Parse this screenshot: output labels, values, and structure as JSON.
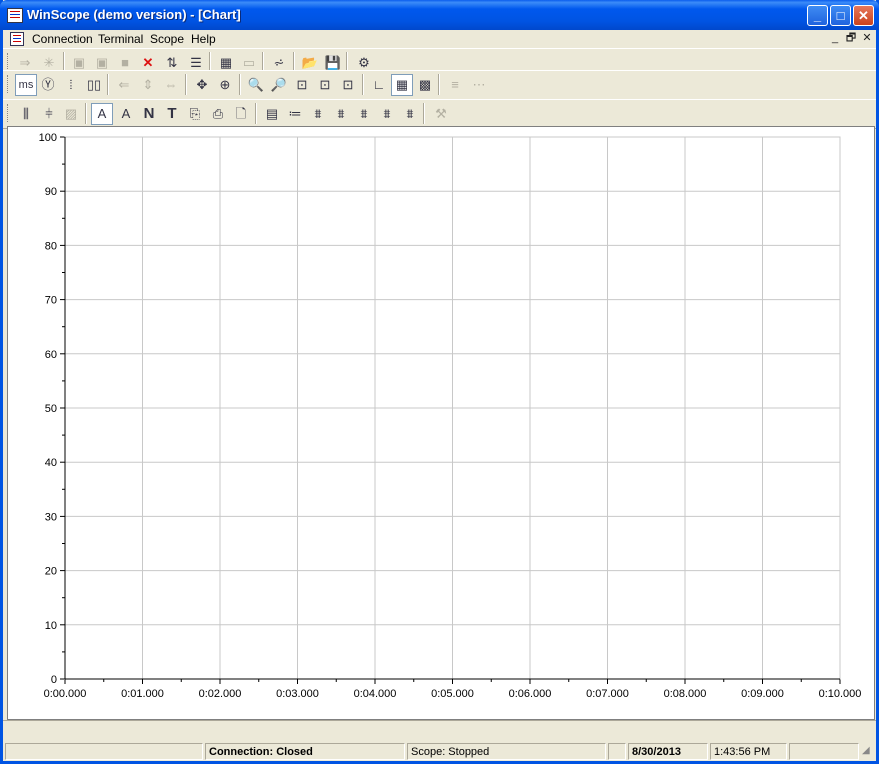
{
  "window": {
    "title": "WinScope (demo version) - [Chart]",
    "controls": {
      "minimize": "_",
      "maximize": "□",
      "close": "✕"
    }
  },
  "menu": {
    "items": [
      "Connection",
      "Terminal",
      "Scope",
      "Help"
    ],
    "mdi_controls": [
      "_",
      "🗗",
      "✕"
    ]
  },
  "toolbar1": {
    "buttons": [
      {
        "icon": "connect-icon",
        "glyph": "⇒",
        "enabled": false
      },
      {
        "icon": "disconnect-icon",
        "glyph": "✳",
        "enabled": false
      },
      {
        "icon": "run-icon",
        "glyph": "▣",
        "enabled": false
      },
      {
        "icon": "single-icon",
        "glyph": "▣",
        "enabled": false
      },
      {
        "icon": "stop-icon",
        "glyph": "■",
        "enabled": false
      },
      {
        "icon": "delete-icon",
        "glyph": "✕",
        "enabled": true
      },
      {
        "icon": "channels-icon",
        "glyph": "⇅",
        "enabled": true
      },
      {
        "icon": "list-icon",
        "glyph": "☰",
        "enabled": true
      },
      {
        "icon": "layout-icon",
        "glyph": "▦",
        "enabled": true
      },
      {
        "icon": "window-icon",
        "glyph": "▭",
        "enabled": false
      },
      {
        "icon": "chart-icon",
        "glyph": "⩫",
        "enabled": true
      },
      {
        "icon": "open-icon",
        "glyph": "📂",
        "enabled": true
      },
      {
        "icon": "save-icon",
        "glyph": "💾",
        "enabled": false
      },
      {
        "icon": "settings-icon",
        "glyph": "⚙",
        "enabled": true
      }
    ]
  },
  "toolbar2": {
    "ms_label": "ms",
    "buttons": [
      {
        "icon": "scale-y-icon",
        "glyph": "Ⓨ",
        "enabled": true
      },
      {
        "icon": "scale-x-icon",
        "glyph": "⦙",
        "enabled": true
      },
      {
        "icon": "digits-icon",
        "glyph": "▯▯",
        "enabled": true
      },
      {
        "icon": "arrow-left-icon",
        "glyph": "⇐",
        "enabled": false
      },
      {
        "icon": "expand-v-icon",
        "glyph": "⇕",
        "enabled": false
      },
      {
        "icon": "expand-h-icon",
        "glyph": "⇔",
        "enabled": false
      },
      {
        "icon": "pan-icon",
        "glyph": "✥",
        "enabled": true
      },
      {
        "icon": "zoom-move-icon",
        "glyph": "⊕",
        "enabled": true
      },
      {
        "icon": "zoom-in-icon",
        "glyph": "🔍",
        "enabled": true
      },
      {
        "icon": "zoom-out-icon",
        "glyph": "🔎",
        "enabled": true
      },
      {
        "icon": "zoom-box-icon",
        "glyph": "⊡",
        "enabled": true
      },
      {
        "icon": "zoom-fit-icon",
        "glyph": "⊡",
        "enabled": true
      },
      {
        "icon": "zoom-reset-icon",
        "glyph": "⊡",
        "enabled": true
      },
      {
        "icon": "axes-icon",
        "glyph": "∟",
        "enabled": true
      },
      {
        "icon": "grid-icon",
        "glyph": "▦",
        "enabled": true
      },
      {
        "icon": "grid-dense-icon",
        "glyph": "▩",
        "enabled": true
      },
      {
        "icon": "lines-icon",
        "glyph": "≡",
        "enabled": false
      },
      {
        "icon": "dotted-lines-icon",
        "glyph": "⋯",
        "enabled": false
      }
    ]
  },
  "toolbar3": {
    "buttons": [
      {
        "icon": "cursor-v-icon",
        "glyph": "⫼",
        "enabled": true
      },
      {
        "icon": "cursor-h-icon",
        "glyph": "⫩",
        "enabled": true
      },
      {
        "icon": "copy-icon",
        "glyph": "▨",
        "enabled": false
      },
      {
        "icon": "font-a-icon",
        "glyph": "A",
        "enabled": true
      },
      {
        "icon": "font-style-icon",
        "glyph": "A",
        "enabled": true
      },
      {
        "icon": "text-n-icon",
        "glyph": "N",
        "enabled": true
      },
      {
        "icon": "text-t-icon",
        "glyph": "T",
        "enabled": true
      },
      {
        "icon": "export-icon",
        "glyph": "⎘",
        "enabled": true
      },
      {
        "icon": "print-icon",
        "glyph": "⎙",
        "enabled": true
      },
      {
        "icon": "preview-icon",
        "glyph": "🗋",
        "enabled": true
      },
      {
        "icon": "table-icon",
        "glyph": "▤",
        "enabled": true
      },
      {
        "icon": "legend-icon",
        "glyph": "≔",
        "enabled": true
      },
      {
        "icon": "plot1-icon",
        "glyph": "⩩",
        "enabled": true
      },
      {
        "icon": "plot2-icon",
        "glyph": "⩩",
        "enabled": true
      },
      {
        "icon": "plot3-icon",
        "glyph": "⩩",
        "enabled": true
      },
      {
        "icon": "plot4-icon",
        "glyph": "⩩",
        "enabled": true
      },
      {
        "icon": "plot5-icon",
        "glyph": "⩩",
        "enabled": true
      },
      {
        "icon": "properties-icon",
        "glyph": "⚒",
        "enabled": false
      }
    ]
  },
  "chart_data": {
    "type": "line",
    "series": [],
    "x_ticks": [
      "0:00.000",
      "0:01.000",
      "0:02.000",
      "0:03.000",
      "0:04.000",
      "0:05.000",
      "0:06.000",
      "0:07.000",
      "0:08.000",
      "0:09.000",
      "0:10.000"
    ],
    "y_ticks": [
      "0",
      "10",
      "20",
      "30",
      "40",
      "50",
      "60",
      "70",
      "80",
      "90",
      "100"
    ],
    "xlim": [
      0,
      10
    ],
    "ylim": [
      0,
      100
    ],
    "grid": true,
    "grid_color": "#c8c8c8"
  },
  "status": {
    "connection": "Connection: Closed",
    "scope": "Scope: Stopped",
    "date": "8/30/2013",
    "time": "1:43:56 PM"
  }
}
